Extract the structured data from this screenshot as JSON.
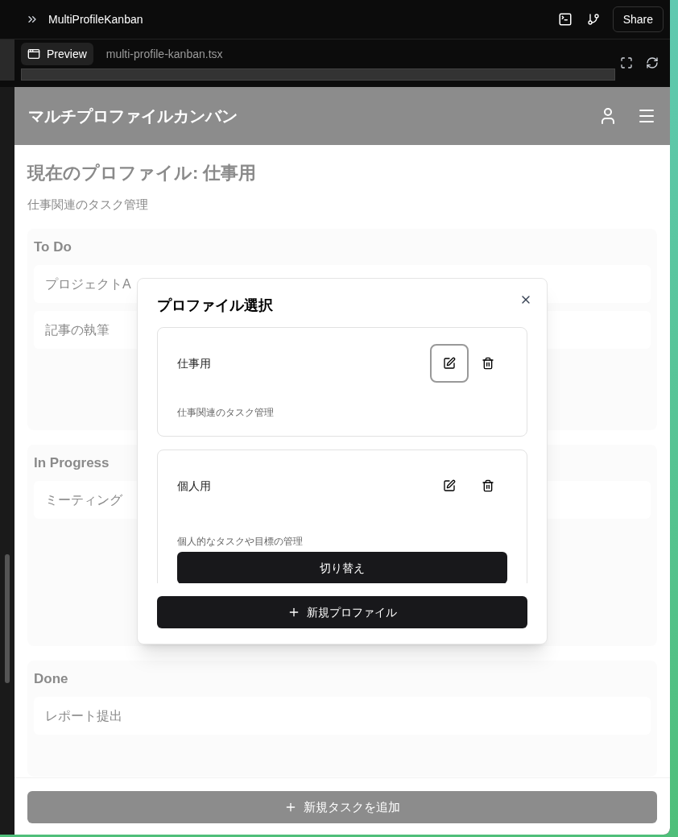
{
  "editor": {
    "project_title": "MultiProfileKanban",
    "share_label": "Share",
    "tabs": [
      {
        "label": "Preview",
        "selected": true
      },
      {
        "label": "multi-profile-kanban.tsx",
        "selected": false
      }
    ]
  },
  "app": {
    "title": "マルチプロファイルカンバン",
    "current_heading": "現在のプロファイル: 仕事用",
    "current_description": "仕事関連のタスク管理",
    "columns": [
      {
        "title": "To Do",
        "tasks": [
          "プロジェクトA",
          "記事の執筆"
        ]
      },
      {
        "title": "In Progress",
        "tasks": [
          "ミーティング"
        ]
      },
      {
        "title": "Done",
        "tasks": [
          "レポート提出"
        ]
      }
    ],
    "add_task_label": "新規タスクを追加"
  },
  "dialog": {
    "title": "プロファイル選択",
    "profiles": [
      {
        "name": "仕事用",
        "description": "仕事関連のタスク管理",
        "selected": true,
        "edit_focused": true
      },
      {
        "name": "個人用",
        "description": "個人的なタスクや目標の管理",
        "selected": false,
        "edit_focused": false,
        "switch_label": "切り替え"
      }
    ],
    "new_profile_label": "新規プロファイル"
  }
}
